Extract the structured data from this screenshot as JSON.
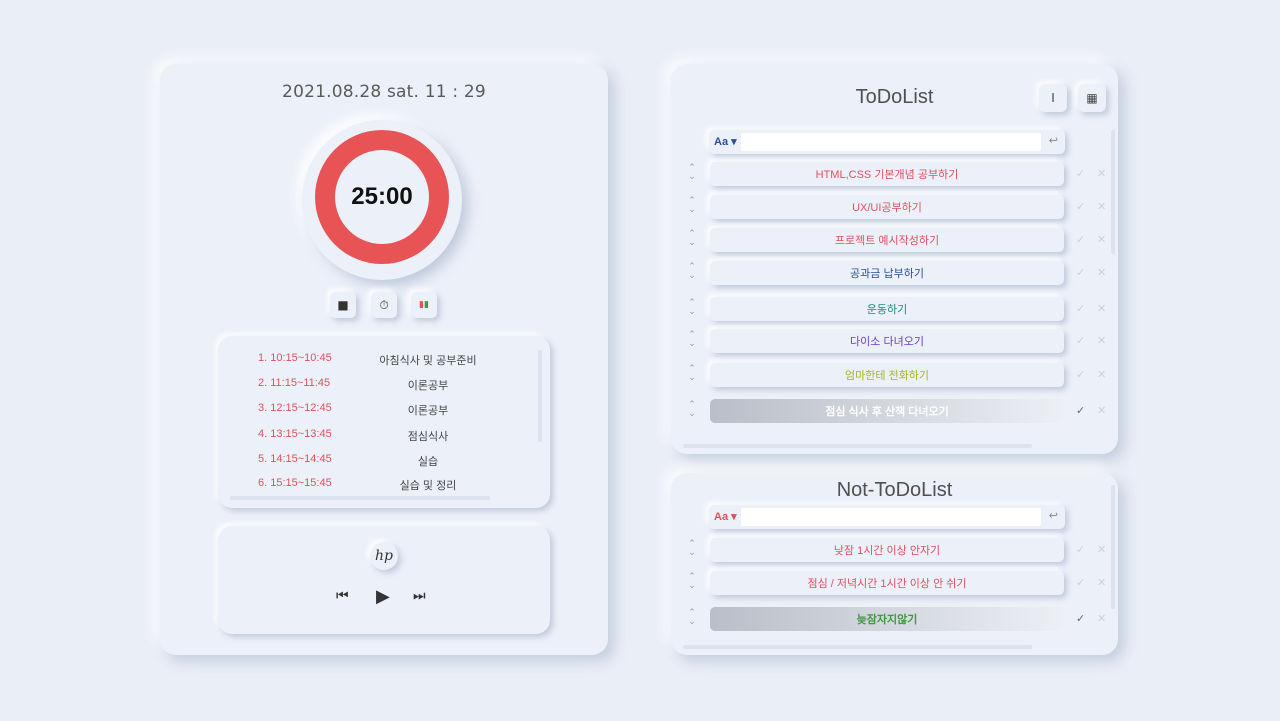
{
  "left": {
    "datetime": "2021.08.28 sat. 11 : 29",
    "timer": "25:00",
    "controls": [
      {
        "name": "stop-button",
        "icon": "stop-icon",
        "glyph": "■"
      },
      {
        "name": "stopwatch-button",
        "icon": "stopwatch-icon",
        "glyph": "⏱"
      },
      {
        "name": "pause-button",
        "icon": "pause-icon",
        "glyph": "▮▮"
      }
    ],
    "schedule": [
      {
        "time": "1. 10:15~10:45",
        "task": "아침식사 및 공부준비"
      },
      {
        "time": "2. 11:15~11:45",
        "task": "이론공부"
      },
      {
        "time": "3. 12:15~12:45",
        "task": "이론공부"
      },
      {
        "time": "4. 13:15~13:45",
        "task": "점심식사"
      },
      {
        "time": "5. 14:15~14:45",
        "task": "실습"
      },
      {
        "time": "6. 15:15~15:45",
        "task": "실습 및 정리"
      }
    ],
    "music": {
      "logo": "hp",
      "prev": "⏮",
      "play": "▶",
      "next": "⏭"
    }
  },
  "todo": {
    "title": "ToDoList",
    "view_list_glyph": "I",
    "view_grid_glyph": "▦",
    "input": {
      "aa": "Aa ▾",
      "placeholder": "",
      "enter": "↩"
    },
    "items": [
      {
        "text": "HTML,CSS 기본개념 공부하기",
        "color": "#e0505c",
        "done": false
      },
      {
        "text": "UX/UI공부하기",
        "color": "#e0505c",
        "done": false
      },
      {
        "text": "프로젝트 예시작성하기",
        "color": "#e0505c",
        "done": false
      },
      {
        "text": "공과금 납부하기",
        "color": "#2f4f9e",
        "done": false
      },
      {
        "text": "운동하기",
        "color": "#1e8a7a",
        "done": false
      },
      {
        "text": "다이소 다녀오기",
        "color": "#6a3fc4",
        "done": false
      },
      {
        "text": "엄마한테 전화하기",
        "color": "#a6b51f",
        "done": false
      },
      {
        "text": "점심 식사 후 산책 다녀오기",
        "color": "#ffffff",
        "done": true
      }
    ]
  },
  "nottodo": {
    "title": "Not-ToDoList",
    "input": {
      "aa": "Aa ▾",
      "placeholder": "",
      "enter": "↩"
    },
    "items": [
      {
        "text": "낮잠 1시간 이상 안자기",
        "color": "#e0505c",
        "done": false
      },
      {
        "text": "점심 / 저녁시간 1시간 이상 안 쉬기",
        "color": "#e0505c",
        "done": false
      },
      {
        "text": "늦잠자지않기",
        "color": "#3f9a3f",
        "done": true
      }
    ]
  },
  "colors": {
    "accent_red": "#e85456",
    "background": "#e9eef7"
  }
}
